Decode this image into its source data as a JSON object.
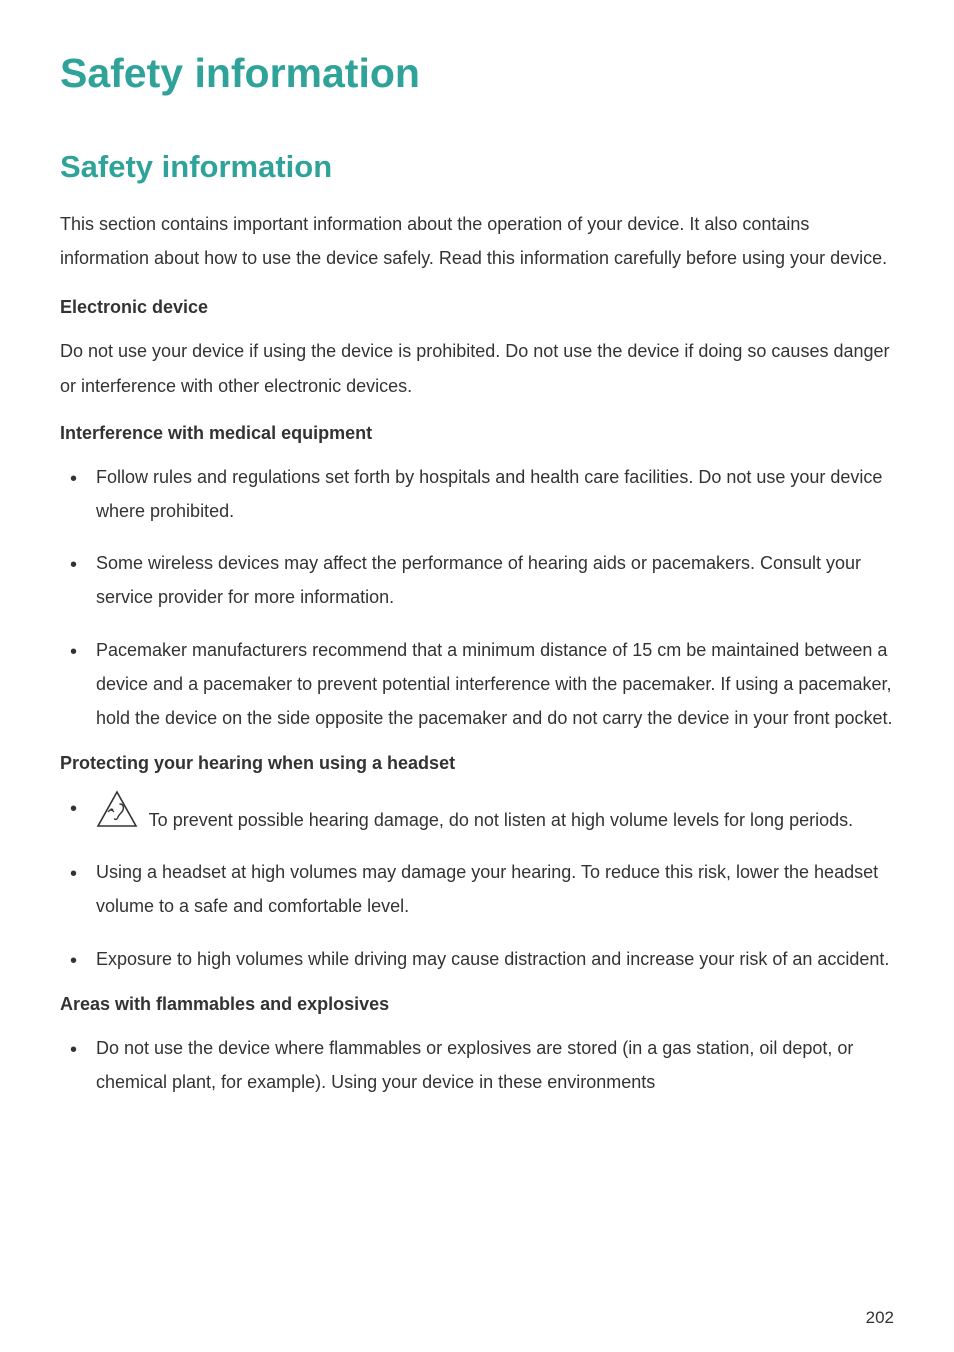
{
  "accent_color": "#2FA39A",
  "title": "Safety information",
  "section_title": "Safety information",
  "intro": "This section contains important information about the operation of your device. It also contains information about how to use the device safely. Read this information carefully before using your device.",
  "electronic": {
    "heading": "Electronic device",
    "body": "Do not use your device if using the device is prohibited. Do not use the device if doing so causes danger or interference with other electronic devices."
  },
  "medical": {
    "heading": "Interference with medical equipment",
    "items": [
      "Follow rules and regulations set forth by hospitals and health care facilities. Do not use your device where prohibited.",
      "Some wireless devices may affect the performance of hearing aids or pacemakers. Consult your service provider for more information.",
      "Pacemaker manufacturers recommend that a minimum distance of 15 cm be maintained between a device and a pacemaker to prevent potential interference with the pacemaker. If using a pacemaker, hold the device on the side opposite the pacemaker and do not carry the device in your front pocket."
    ]
  },
  "hearing": {
    "heading": "Protecting your hearing when using a headset",
    "items": [
      " To prevent possible hearing damage, do not listen at high volume levels for long periods.",
      "Using a headset at high volumes may damage your hearing. To reduce this risk, lower the headset volume to a safe and comfortable level.",
      "Exposure to high volumes while driving may cause distraction and increase your risk of an accident."
    ]
  },
  "flammables": {
    "heading": "Areas with flammables and explosives",
    "items": [
      "Do not use the device where flammables or explosives are stored (in a gas station, oil depot, or chemical plant, for example). Using your device in these environments"
    ]
  },
  "page_number": "202"
}
